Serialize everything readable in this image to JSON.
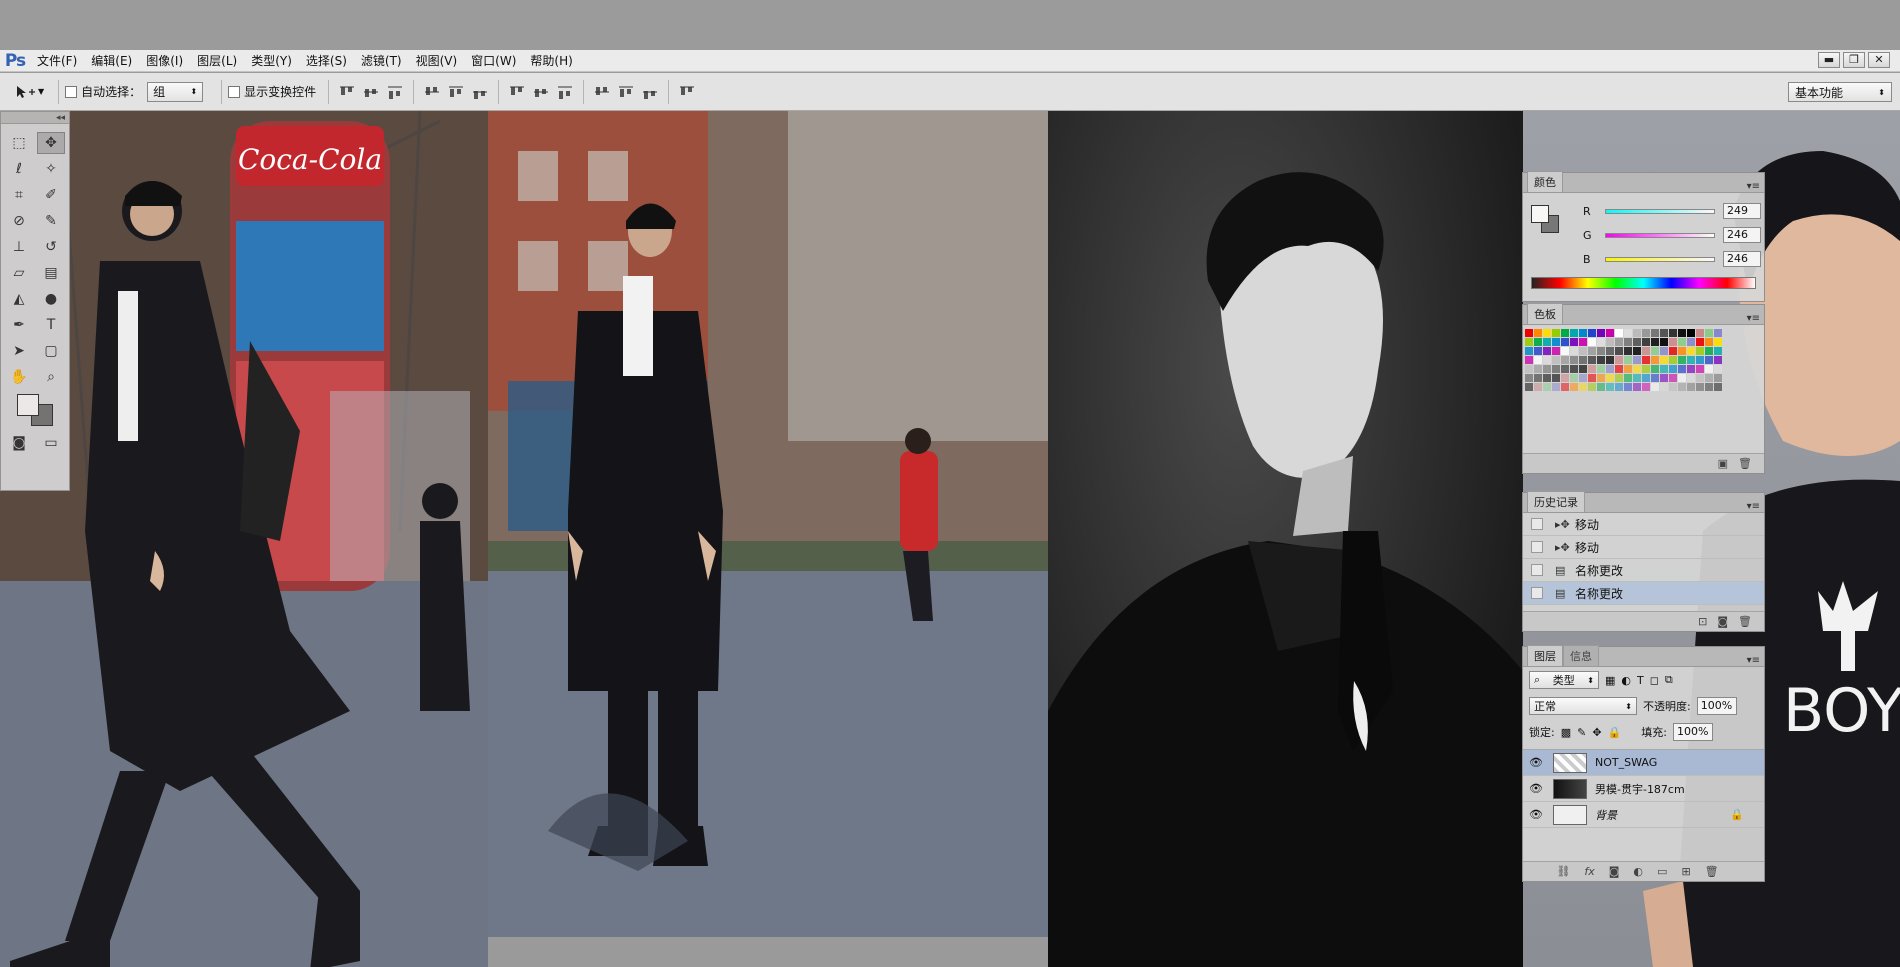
{
  "app": {
    "logo": "Ps"
  },
  "menubar": {
    "items": [
      "文件(F)",
      "编辑(E)",
      "图像(I)",
      "图层(L)",
      "类型(Y)",
      "选择(S)",
      "滤镜(T)",
      "视图(V)",
      "窗口(W)",
      "帮助(H)"
    ]
  },
  "window_controls": {
    "minimize": "▬",
    "restore": "❐",
    "close": "✕"
  },
  "options_bar": {
    "auto_select_label": "自动选择：",
    "auto_select_value": "组",
    "show_transform_label": "显示变换控件",
    "workspace": "基本功能"
  },
  "color_panel": {
    "tab": "颜色",
    "r_label": "R",
    "r_value": "249",
    "g_label": "G",
    "g_value": "246",
    "b_label": "B",
    "b_value": "246"
  },
  "swatches_panel": {
    "tab": "色板"
  },
  "history_panel": {
    "tab": "历史记录",
    "items": [
      "移动",
      "移动",
      "名称更改",
      "名称更改"
    ]
  },
  "layers_panel": {
    "tab": "图层",
    "tab2": "信息",
    "filter_kind": "类型",
    "blend_mode": "正常",
    "opacity_label": "不透明度:",
    "opacity_value": "100%",
    "lock_label": "锁定:",
    "fill_label": "填充:",
    "fill_value": "100%",
    "layers": [
      "NOT_SWAG",
      "男模-贯宇-187cm",
      "背景"
    ]
  },
  "canvas": {
    "sign_text": "Coca-Cola",
    "shirt_text": "BOY"
  },
  "colors": {
    "accent": "#3563b3",
    "selection": "#a9b8d3"
  }
}
